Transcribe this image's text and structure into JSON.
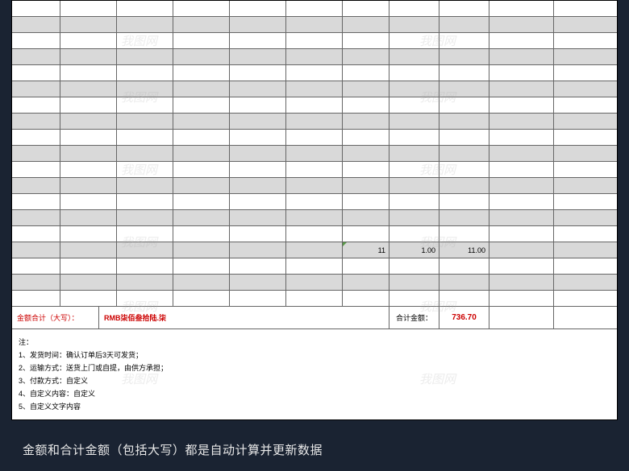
{
  "data_row": {
    "qty": "11",
    "price": "1.00",
    "amount": "11.00"
  },
  "total": {
    "label": "金额合计（大写）：",
    "words": "RMB柒佰叁拾陆.柒",
    "sum_label": "合计金额：",
    "sum_value": "736.70"
  },
  "notes": {
    "header": "注：",
    "n1": "1、发货时间：确认订单后3天可发货；",
    "n2": "2、运输方式：送货上门或自提，由供方承担；",
    "n3": "3、付款方式：自定义",
    "n4": "4、自定义内容：自定义",
    "n5": "5、自定义文字内容"
  },
  "caption": "金额和合计金额（包括大写）都是自动计算并更新数据",
  "watermark": "我图网"
}
